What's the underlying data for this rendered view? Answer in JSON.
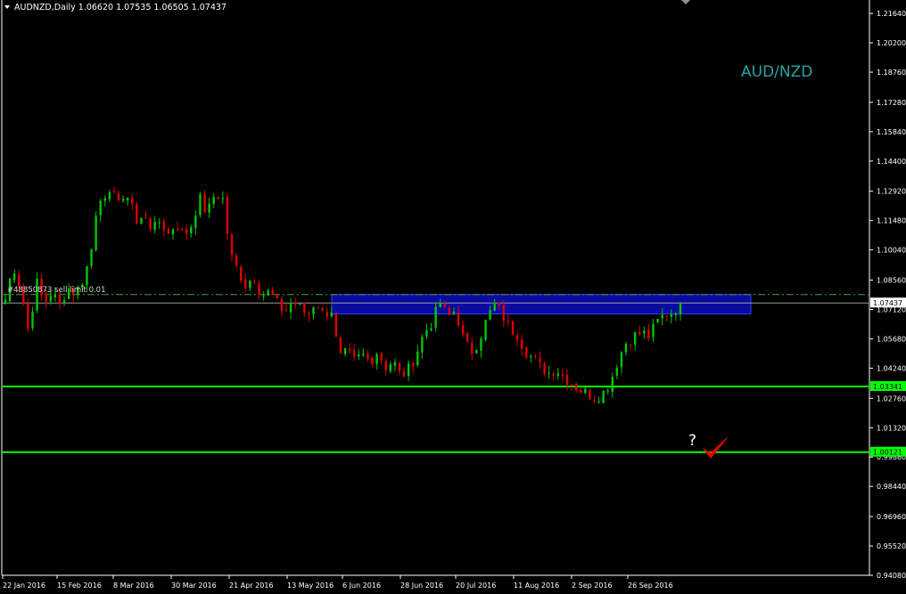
{
  "header": {
    "title": "AUDNZD,Daily  1.06620 1.07535 1.06505 1.07437",
    "dropdown_icon": "triangle-down-icon"
  },
  "watermark": "AUD/NZD",
  "order_label": "#48850873 sell limit 0.01",
  "annotation": {
    "question": "?",
    "check_icon": "check-mark-icon"
  },
  "price_tags": {
    "current": "1.07437",
    "support_1": "1.03341",
    "support_2": "1.00121"
  },
  "colors": {
    "background": "#000000",
    "axis": "#ffffff",
    "bull": "#00c800",
    "bear": "#e00000",
    "level_line": "#00ff00",
    "zone_fill": "#0a0aa0",
    "zone_border": "#3c3cff",
    "watermark": "#2aa3a3",
    "order_line": "#40a040",
    "check": "#e00000"
  },
  "chart_data": {
    "type": "candlestick",
    "symbol": "AUDNZD",
    "timeframe": "Daily",
    "ylim": [
      0.9408,
      1.223
    ],
    "y_ticks": [
      "1.21640",
      "1.20200",
      "1.18760",
      "1.17280",
      "1.15840",
      "1.14400",
      "1.12920",
      "1.11480",
      "1.10040",
      "1.08560",
      "1.07120",
      "1.05680",
      "1.04240",
      "1.02760",
      "1.01320",
      "0.99880",
      "0.98440",
      "0.96960",
      "0.95520",
      "0.94080"
    ],
    "x_ticks": [
      "22 Jan 2016",
      "15 Feb 2016",
      "8 Mar 2016",
      "30 Mar 2016",
      "21 Apr 2016",
      "13 May 2016",
      "6 Jun 2016",
      "28 Jun 2016",
      "20 Jul 2016",
      "11 Aug 2016",
      "2 Sep 2016",
      "26 Sep 2016"
    ],
    "anchors": [
      [
        1.076,
        1.093,
        1.081,
        1.06,
        1.085,
        1.074,
        1.08,
        1.073,
        1.082,
        1.079,
        1.086
      ],
      [
        1.086,
        1.098,
        1.129,
        1.122,
        1.131,
        1.121,
        1.13,
        1.112,
        1.118,
        1.11
      ],
      [
        1.11,
        1.115,
        1.108,
        1.114,
        1.107,
        1.113,
        1.126,
        1.118,
        1.128,
        1.126
      ],
      [
        1.126,
        1.098,
        1.09,
        1.083,
        1.088,
        1.078,
        1.08,
        1.074,
        1.07,
        1.075
      ],
      [
        1.075,
        1.072,
        1.068,
        1.076,
        1.068,
        1.072,
        1.047,
        1.05,
        1.046,
        1.049
      ],
      [
        1.049,
        1.046,
        1.051,
        1.043,
        1.046,
        1.038,
        1.042,
        1.05,
        1.06,
        1.065
      ],
      [
        1.065,
        1.075,
        1.067,
        1.071,
        1.057,
        1.05,
        1.056,
        1.066,
        1.074,
        1.069
      ],
      [
        1.069,
        1.062,
        1.059,
        1.051,
        1.047,
        1.043,
        1.04,
        1.042,
        1.038,
        1.035
      ],
      [
        1.035,
        1.032,
        1.03,
        1.028,
        1.03,
        1.036,
        1.047,
        1.055,
        1.058,
        1.06
      ],
      [
        1.06,
        1.058,
        1.065,
        1.069,
        1.07,
        1.0743
      ]
    ],
    "candle_count": 150,
    "last_close": 1.07437,
    "levels": [
      {
        "name": "support-1",
        "price": 1.03341
      },
      {
        "name": "support-2",
        "price": 1.00121
      }
    ],
    "zone": {
      "top": 1.0785,
      "bottom": 1.069
    },
    "order_price": 1.0785
  }
}
